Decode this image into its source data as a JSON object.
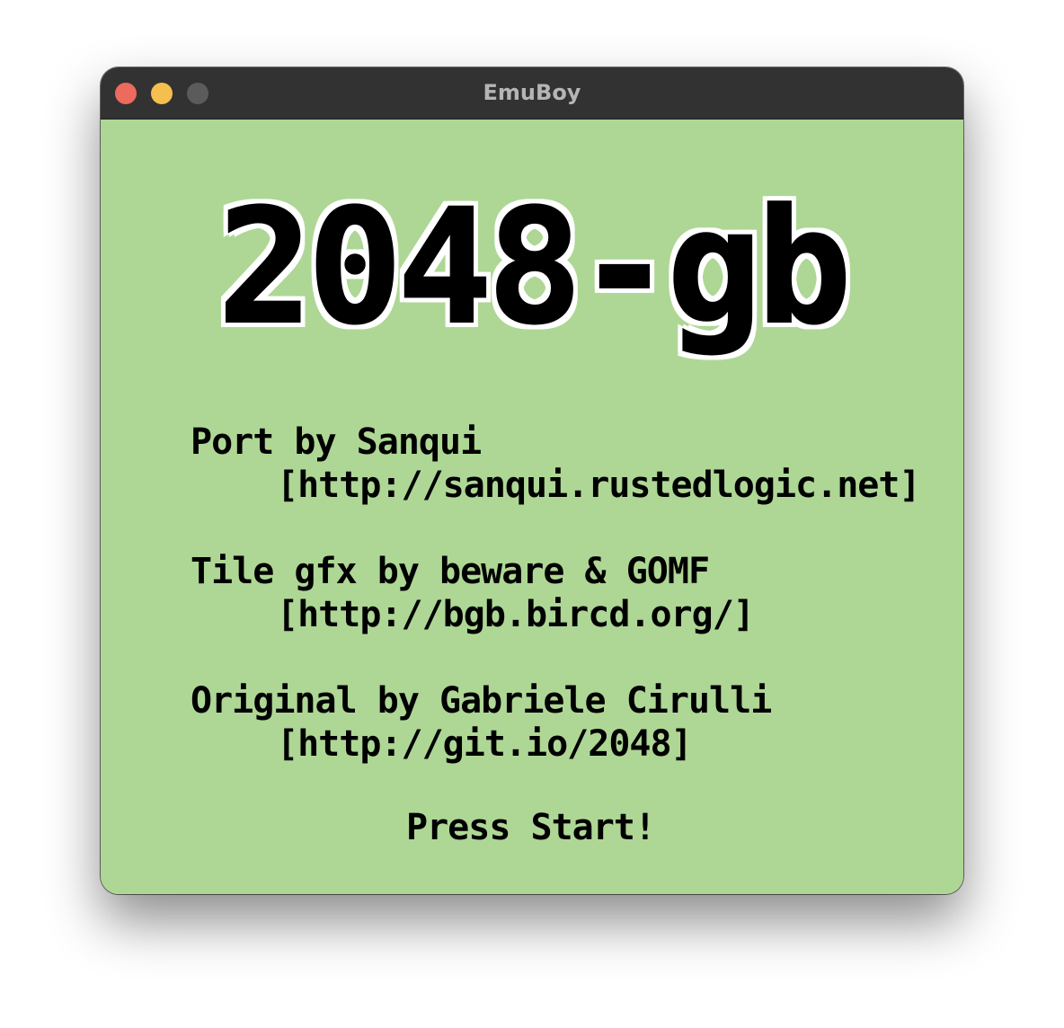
{
  "window": {
    "title": "EmuBoy"
  },
  "screen": {
    "logo": "2048-gb",
    "credits": [
      {
        "label": "Port by Sanqui",
        "url": "[http://sanqui.rustedlogic.net]"
      },
      {
        "label": "Tile gfx by beware & GOMF",
        "url": "[http://bgb.bircd.org/]"
      },
      {
        "label": "Original by Gabriele Cirulli",
        "url": "[http://git.io/2048]"
      }
    ],
    "prompt": "Press Start!"
  },
  "colors": {
    "screen_bg": "#aed795",
    "text": "#000000",
    "titlebar": "#323232",
    "close": "#ed6a5e",
    "minimize": "#f5bf4f",
    "zoom": "#5b5b5b"
  }
}
